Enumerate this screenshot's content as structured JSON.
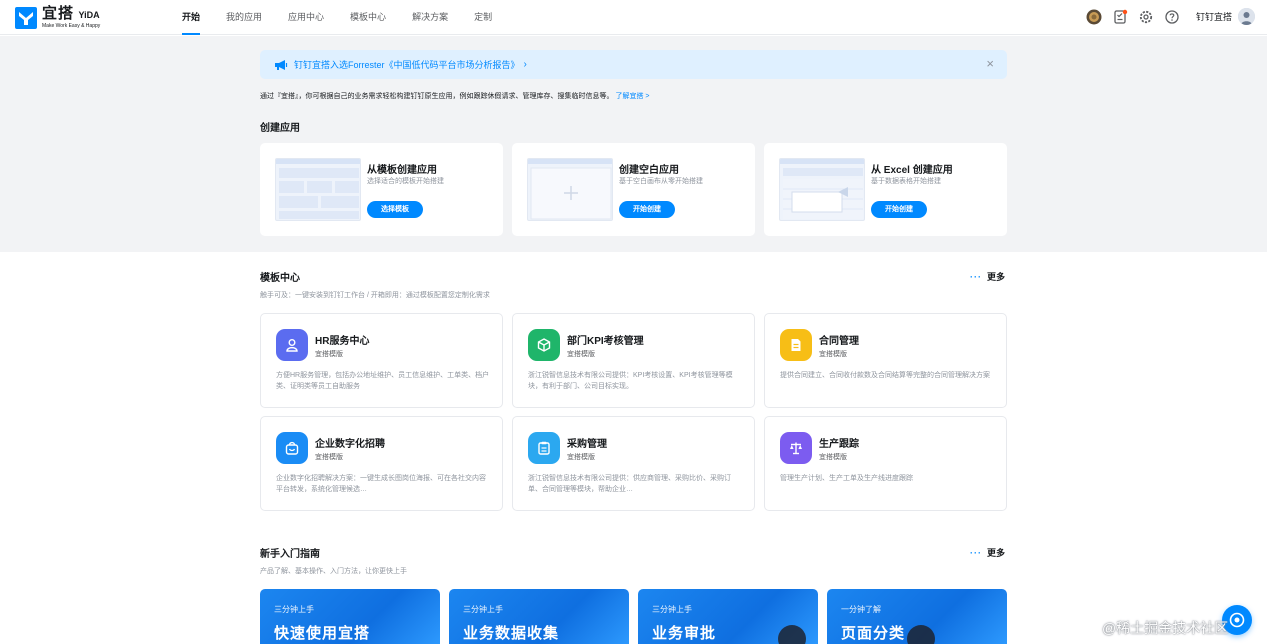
{
  "brand": {
    "name_cn": "宜搭",
    "name_en": "YiDA",
    "slogan": "Make Work Easy & Happy",
    "color": "#0089ff"
  },
  "nav": {
    "items": [
      {
        "label": "开始",
        "active": true
      },
      {
        "label": "我的应用"
      },
      {
        "label": "应用中心"
      },
      {
        "label": "模板中心"
      },
      {
        "label": "解决方案"
      },
      {
        "label": "定制"
      }
    ]
  },
  "header_right": {
    "icons": [
      "coin-icon",
      "todo-icon",
      "gear-icon",
      "help-icon"
    ],
    "user_name": "钉钉宜搭"
  },
  "notice": {
    "text": "钉钉宜搭入选Forrester《中国低代码平台市场分析报告》",
    "chevron": "›",
    "close": "×"
  },
  "intro": {
    "text": "通过『宜搭』，你可根据自己的业务需求轻松构建钉钉原生应用，例如跟踪休假请求、管理库存、搜集临时信息等。",
    "link": "了解宜搭 >"
  },
  "create": {
    "title": "创建应用",
    "cards": [
      {
        "title": "从模板创建应用",
        "desc": "选择适合的模板开始搭建",
        "button": "选择模板"
      },
      {
        "title": "创建空白应用",
        "desc": "基于空白画布从零开始搭建",
        "button": "开始创建"
      },
      {
        "title": "从 Excel 创建应用",
        "desc": "基于数据表格开始搭建",
        "button": "开始创建"
      }
    ]
  },
  "templates": {
    "title": "模板中心",
    "subtitle": "触手可及：一键安装到钉钉工作台 / 开箱即用：通过模板配置您定制化需求",
    "more": "更多",
    "more_dots": "···",
    "cards": [
      {
        "name": "HR服务中心",
        "tag": "宜搭模版",
        "desc": "方便HR服务管理，包括办公地址维护、员工信息维护、工单类、档户类、证明类等员工自助服务",
        "color": "#5b6cf0",
        "icon": "person-icon"
      },
      {
        "name": "部门KPI考核管理",
        "tag": "宜搭模版",
        "desc": "浙江锐智信息技术有限公司提供：KPI考核设置、KPI考核管理等模块，有利于部门、公司目标实现。",
        "color": "#1fb56a",
        "icon": "box-icon"
      },
      {
        "name": "合同管理",
        "tag": "宜搭模版",
        "desc": "提供合同建立、合同收付款数及合同结算等完整的合同管理解决方案",
        "color": "#f7be16",
        "icon": "document-icon"
      },
      {
        "name": "企业数字化招聘",
        "tag": "宜搭模版",
        "desc": "企业数字化招聘解决方案：一键生成长图岗位海报、可在各社交内容平台转发，系统化管理候选…",
        "color": "#1a8cf5",
        "icon": "bag-icon"
      },
      {
        "name": "采购管理",
        "tag": "宜搭模版",
        "desc": "浙江锐智信息技术有限公司提供：供应商管理、采购比价、采购订单、合同管理等模块，帮助企业…",
        "color": "#2ba8f0",
        "icon": "clipboard-icon"
      },
      {
        "name": "生产跟踪",
        "tag": "宜搭模版",
        "desc": "管理生产计划、生产工单及生产线进度跟踪",
        "color": "#7c5cf0",
        "icon": "scale-icon"
      }
    ]
  },
  "guide": {
    "title": "新手入门指南",
    "subtitle": "产品了解、基本操作、入门方法，让你更快上手",
    "more": "更多",
    "more_dots": "···",
    "cards": [
      {
        "sub": "三分钟上手",
        "title": "快速使用宜搭"
      },
      {
        "sub": "三分钟上手",
        "title": "业务数据收集"
      },
      {
        "sub": "三分钟上手",
        "title": "业务审批"
      },
      {
        "sub": "一分钟了解",
        "title": "页面分类"
      }
    ]
  },
  "watermark": "@稀土掘金技术社区"
}
